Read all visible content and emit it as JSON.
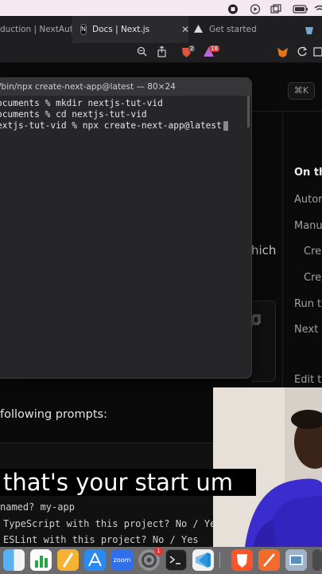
{
  "tabs": [
    {
      "label": "duction | NextAuth.js",
      "active": false
    },
    {
      "label": "Docs | Next.js",
      "active": true,
      "close": "✕"
    },
    {
      "label": "Get started",
      "active": false
    }
  ],
  "toolbar": {
    "brave_badge": "2",
    "rewards_badge": "18"
  },
  "page": {
    "kbd_shortcut": "⌘K",
    "on_this_page": "On th",
    "toc": [
      "Autor",
      "Manu",
      "Cre",
      "Cre",
      "Run t",
      "Next"
    ],
    "edit_link": "Edit t",
    "body_fragment": "hich",
    "prompts_text": "following prompts:",
    "cli_lines": [
      "named? my-app",
      "TypeScript with this project? No / Ye",
      "ESLint with this project? No / Yes"
    ]
  },
  "terminal": {
    "title": "/bin/npx create-next-app@latest — 80×24",
    "lines": [
      "ocuments % mkdir nextjs-tut-vid",
      "ocuments % cd nextjs-tut-vid",
      "extjs-tut-vid % npx create-next-app@latest"
    ]
  },
  "caption": "that's your start um",
  "dock_items": [
    "finder",
    "numbers",
    "pages",
    "app-store",
    "zoom",
    "system-settings",
    "terminal",
    "vscode",
    "brave",
    "sketch",
    "preview"
  ],
  "dock_labels": {
    "zoom": "zoom",
    "settings_badge": "1"
  },
  "colors": {
    "accent": "#2f6fed",
    "terminal_bg": "#262628",
    "page_bg": "#0a0a0a"
  }
}
